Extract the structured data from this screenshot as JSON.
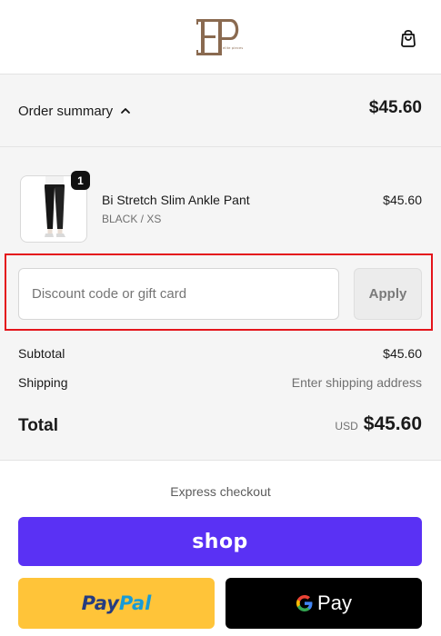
{
  "header": {
    "logo_icon": "ep-monogram-logo",
    "logo_tagline": "elite pieces",
    "cart_icon": "shopping-bag-icon"
  },
  "summary": {
    "toggle_label": "Order summary",
    "chevron_icon": "chevron-up-icon",
    "total": "$45.60"
  },
  "line_items": [
    {
      "name": "Bi Stretch Slim Ankle Pant",
      "variant": "BLACK / XS",
      "price": "$45.60",
      "quantity": "1"
    }
  ],
  "discount": {
    "placeholder": "Discount code or gift card",
    "value": "",
    "apply_label": "Apply"
  },
  "totals": {
    "subtotal_label": "Subtotal",
    "subtotal_value": "$45.60",
    "shipping_label": "Shipping",
    "shipping_value": "Enter shipping address",
    "total_label": "Total",
    "currency": "USD",
    "total_value": "$45.60"
  },
  "express": {
    "title": "Express checkout",
    "shop_label": "shop",
    "paypal_label_a": "Pay",
    "paypal_label_b": "Pal",
    "gpay_label": "Pay"
  },
  "colors": {
    "shop_purple": "#5a31f4",
    "paypal_yellow": "#ffc439",
    "gpay_black": "#000000",
    "highlight_red": "#e4141b",
    "brand_brown": "#8a6a50"
  }
}
